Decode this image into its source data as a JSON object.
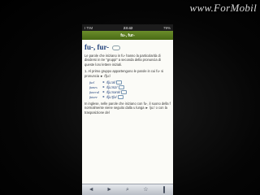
{
  "watermark": "www.ForMobil",
  "status": {
    "carrier": "I TIM",
    "time": "23:42",
    "battery": "79%"
  },
  "app": {
    "title": "fu-, fur-"
  },
  "entry": {
    "headword": "fu-, fur-",
    "intro": "Le parole che iniziano in fu- hanno la particolarità di dividersi in tre \"gruppi\" a seconda della pronuncia di queste loro lettere iniziali.",
    "section1": "1. Al primo gruppo appartengono le parole in cui fu- si pronuncia ► /fju:/",
    "examples": [
      {
        "word": "fuel",
        "ipa": "/fju:əl/"
      },
      {
        "word": "fumes",
        "ipa": "/fju:mz/"
      },
      {
        "word": "funeral",
        "ipa": "/fju:nərəl/"
      },
      {
        "word": "future",
        "ipa": "/fju:tʃə/"
      }
    ],
    "section2": "In inglese, nelle parole che iniziano con fu-, il suono della f normalmente viene seguito dalla u lunga ► /ju:/ o con la trasposizione del"
  },
  "toolbar": {
    "back": "◄",
    "forward": "►",
    "search": "⌕",
    "bookmark": "☆"
  },
  "icons": {
    "headword_audio": "speaker-icon",
    "example_audio": "speaker-icon",
    "book": "book-icon"
  }
}
